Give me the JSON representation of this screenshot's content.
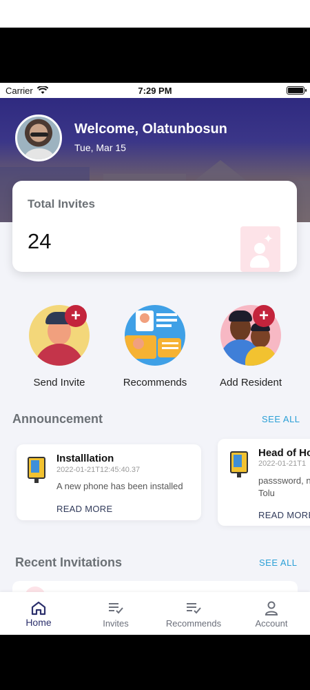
{
  "status_bar": {
    "carrier": "Carrier",
    "time": "7:29 PM"
  },
  "header": {
    "welcome": "Welcome, Olatunbosun",
    "date": "Tue, Mar 15"
  },
  "total_invites": {
    "label": "Total Invites",
    "count": "24"
  },
  "quick_actions": [
    {
      "label": "Send Invite",
      "icon": "send-invite-icon"
    },
    {
      "label": "Recommends",
      "icon": "recommends-icon"
    },
    {
      "label": "Add Resident",
      "icon": "add-resident-icon"
    }
  ],
  "announcement": {
    "title": "Announcement",
    "see_all": "SEE ALL",
    "cards": [
      {
        "title": "Installlation",
        "time": "2022-01-21T12:45:40.37",
        "body": "A new phone has been installed",
        "read_more": "READ MORE"
      },
      {
        "title": "Head of Ho",
        "time": "2022-01-21T1",
        "body_line1": "passsword, n",
        "body_line2": "Tolu",
        "read_more": "READ MORE"
      }
    ]
  },
  "recent_invitations": {
    "title": "Recent Invitations",
    "see_all": "SEE ALL"
  },
  "tabs": [
    {
      "label": "Home",
      "icon": "home-icon",
      "active": true
    },
    {
      "label": "Invites",
      "icon": "list-check-icon",
      "active": false
    },
    {
      "label": "Recommends",
      "icon": "list-check-icon",
      "active": false
    },
    {
      "label": "Account",
      "icon": "person-icon",
      "active": false
    }
  ],
  "colors": {
    "header_bg": "#2f2a80",
    "accent_link": "#2a9fd6",
    "badge_red": "#c3243c",
    "active_tab": "#2b2f6b"
  }
}
